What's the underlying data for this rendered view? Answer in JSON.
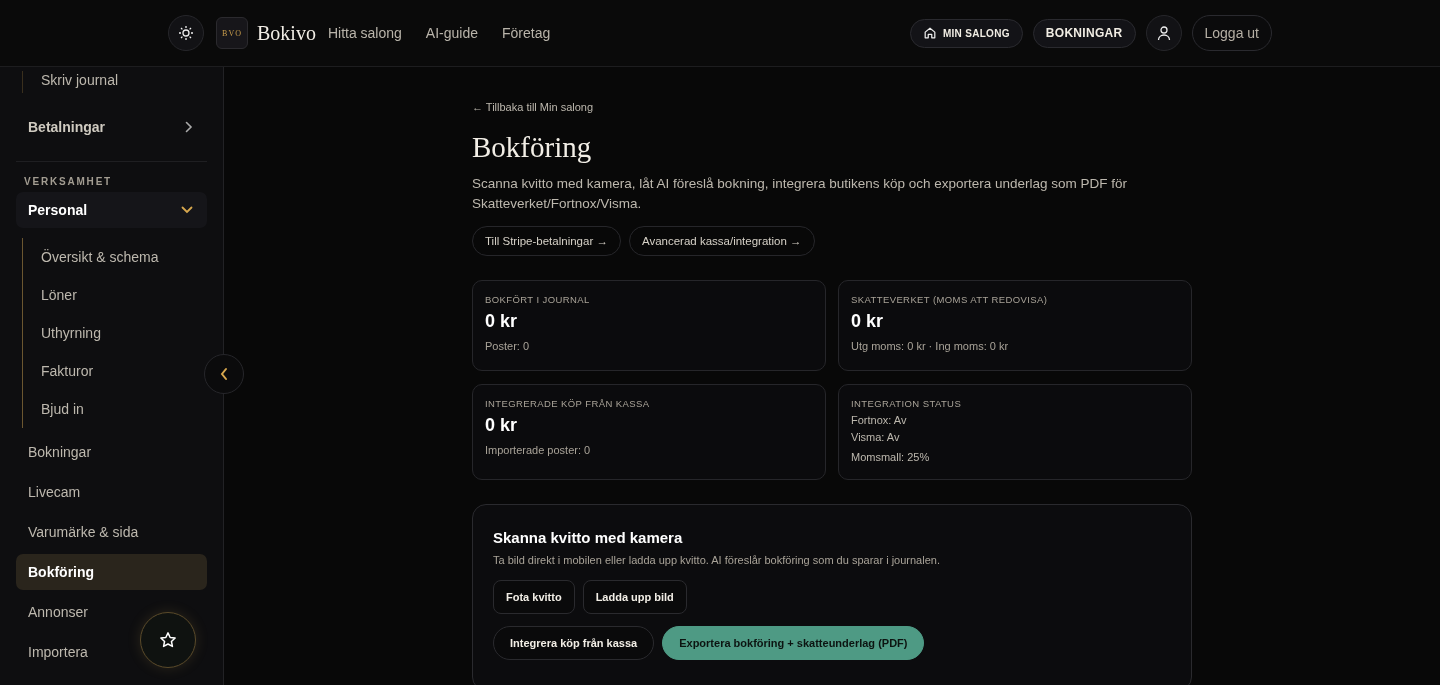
{
  "header": {
    "logo": "BVO",
    "brand": "Bokivo",
    "links": [
      "Hitta salong",
      "AI-guide",
      "Företag"
    ],
    "actions": [
      {
        "kind": "home",
        "label": "MIN SALONG"
      },
      {
        "kind": "pill",
        "label": "BOKNINGAR"
      },
      {
        "kind": "profile"
      },
      {
        "kind": "outline",
        "label": "Logga ut"
      }
    ]
  },
  "sidebar": {
    "items": [
      {
        "kind": "sub",
        "label": "Skriv journal",
        "selected": false
      },
      {
        "kind": "group",
        "label": "Betalningar",
        "expanded": false
      },
      {
        "kind": "heading",
        "label": "VERKSAMHET"
      },
      {
        "kind": "group",
        "label": "Personal",
        "expanded": true,
        "children": [
          {
            "label": "Översikt & schema",
            "selected": false
          },
          {
            "label": "Löner",
            "selected": false
          },
          {
            "label": "Uthyrning",
            "selected": false
          },
          {
            "label": "Fakturor",
            "selected": false
          },
          {
            "label": "Bjud in",
            "selected": false
          }
        ]
      },
      {
        "kind": "link",
        "label": "Bokningar",
        "selected": false
      },
      {
        "kind": "link",
        "label": "Livecam",
        "selected": false
      },
      {
        "kind": "link",
        "label": "Varumärke & sida",
        "selected": false
      },
      {
        "kind": "link",
        "label": "Bokföring",
        "selected": true
      },
      {
        "kind": "link",
        "label": "Annonser",
        "selected": false
      },
      {
        "kind": "link",
        "label": "Importera",
        "selected": false
      }
    ]
  },
  "main": {
    "back_link": "← Tillbaka till Min salong",
    "title": "Bokföring",
    "description": "Scanna kvitto med kamera, låt AI föreslå bokning, integrera butikens köp och exportera underlag som PDF för Skatteverket/Fortnox/Visma.",
    "quick_links": [
      "Till Stripe-betalningar →",
      "Avancerad kassa/integration →"
    ],
    "cards": [
      {
        "label": "BOKFÖRT I JOURNAL",
        "value": "0 kr",
        "note": "Poster: 0"
      },
      {
        "label": "SKATTEVERKET (MOMS ATT REDOVISA)",
        "value": "0 kr",
        "note": "Utg moms: 0 kr · Ing moms: 0 kr"
      },
      {
        "label": "INTEGRERADE KÖP FRÅN KASSA",
        "value": "0 kr",
        "note": "Importerade poster: 0"
      },
      {
        "label": "INTEGRATION STATUS",
        "lines": [
          "Fortnox: Av",
          "Visma: Av"
        ],
        "note": "Momsmall: 25%"
      }
    ],
    "scan_panel": {
      "title": "Skanna kvitto med kamera",
      "text": "Ta bild direkt i mobilen eller ladda upp kvitto. AI föreslår bokföring som du sparar i journalen.",
      "button_rows": [
        [
          {
            "kind": "secondary",
            "label": "Fota kvitto"
          },
          {
            "kind": "secondary",
            "label": "Ladda upp bild"
          }
        ],
        [
          {
            "kind": "secondary",
            "label": "Integrera köp från kassa"
          },
          {
            "kind": "primary",
            "label": "Exportera bokföring + skatteunderlag (PDF)"
          }
        ]
      ]
    }
  }
}
